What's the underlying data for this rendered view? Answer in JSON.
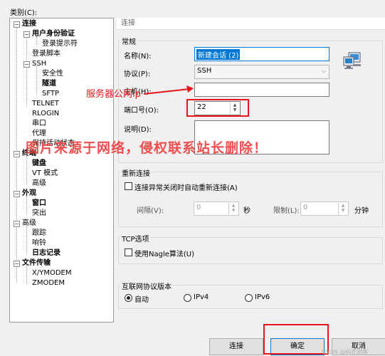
{
  "category_label": "类别(C):",
  "tree": [
    {
      "label": "连接",
      "bold": true
    },
    {
      "label": "用户身份验证",
      "bold": true
    },
    {
      "label": "登录提示符",
      "bold": false
    },
    {
      "label": "登录脚本",
      "bold": false
    },
    {
      "label": "SSH",
      "bold": false
    },
    {
      "label": "安全性",
      "bold": false
    },
    {
      "label": "隧道",
      "bold": true
    },
    {
      "label": "SFTP",
      "bold": false
    },
    {
      "label": "TELNET",
      "bold": false
    },
    {
      "label": "RLOGIN",
      "bold": false
    },
    {
      "label": "串口",
      "bold": false
    },
    {
      "label": "代理",
      "bold": false
    },
    {
      "label": "保持活动状态",
      "bold": false
    },
    {
      "label": "终端",
      "bold": true
    },
    {
      "label": "键盘",
      "bold": true
    },
    {
      "label": "VT 模式",
      "bold": false
    },
    {
      "label": "高级",
      "bold": false
    },
    {
      "label": "外观",
      "bold": true
    },
    {
      "label": "窗口",
      "bold": true
    },
    {
      "label": "突出",
      "bold": false
    },
    {
      "label": "高级",
      "bold": false
    },
    {
      "label": "跟踪",
      "bold": false
    },
    {
      "label": "响铃",
      "bold": false
    },
    {
      "label": "日志记录",
      "bold": true
    },
    {
      "label": "文件传输",
      "bold": true
    },
    {
      "label": "X/YMODEM",
      "bold": false
    },
    {
      "label": "ZMODEM",
      "bold": false
    }
  ],
  "header": "连接",
  "general": {
    "title": "常规",
    "name_label": "名称(N):",
    "name_value": "新建会话 (2)",
    "protocol_label": "协议(P):",
    "protocol_value": "SSH",
    "host_label": "主机(H):",
    "host_value": "",
    "port_label": "端口号(O):",
    "port_value": "22",
    "desc_label": "说明(D):"
  },
  "reconnect": {
    "title": "重新连接",
    "checkbox_label": "连接异常关闭时自动重新连接(A)",
    "interval_label": "间隔(V):",
    "interval_value": "0",
    "seconds": "秒",
    "limit_label": "限制(L):",
    "limit_value": "0",
    "minutes": "分钟"
  },
  "tcp": {
    "title": "TCP选项",
    "nagle_label": "使用Nagle算法(U)"
  },
  "ipver": {
    "title": "互联网协议版本",
    "options": [
      "自动",
      "IPv4",
      "IPv6"
    ],
    "selected": "自动"
  },
  "buttons": {
    "connect": "连接",
    "ok": "确定",
    "cancel": "取消"
  },
  "annotation": "服务器公网ip",
  "watermark": "图片来源于网络，侵权联系站长删除！",
  "csdn": "CSDN @码农刚客"
}
